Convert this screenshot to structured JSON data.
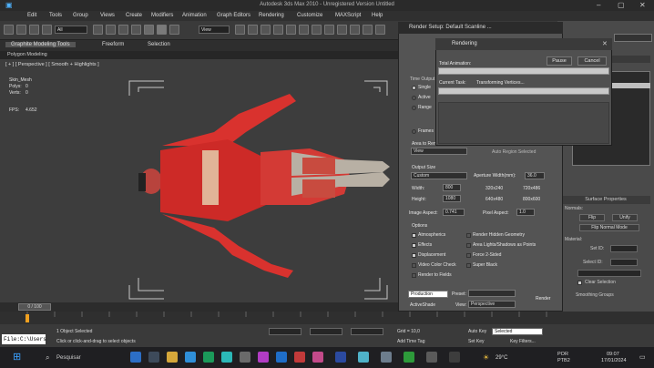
{
  "window": {
    "title": "Autodesk 3ds Max  2010   - Unregistered Version      Untitled"
  },
  "menu": [
    "Edit",
    "Tools",
    "Group",
    "Views",
    "Create",
    "Modifiers",
    "Animation",
    "Graph Editors",
    "Rendering",
    "Customize",
    "MAXScript",
    "Help"
  ],
  "toolbar": {
    "select_filter": "All",
    "ref_coord": "View"
  },
  "ribbon": {
    "tabs": [
      "Graphite Modeling Tools",
      "Freeform",
      "Selection"
    ],
    "sub": "Polygon Modeling"
  },
  "viewport": {
    "label": "[ + ] [ Perspective ] [ Smooth + Highlights ]",
    "stats": {
      "object": "Skin_Mesh",
      "polys_label": "Polys:",
      "polys_value": "0",
      "verts_label": "Verts:",
      "verts_value": "0",
      "fps_label": "FPS:",
      "fps_value": "4.652"
    }
  },
  "time": {
    "position": "0 / 100"
  },
  "render_setup": {
    "title": "Render Setup: Default Scanline ...",
    "time_output": "Time Output",
    "options": [
      "Single",
      "Active",
      "Range",
      "Frames"
    ],
    "area_label": "Area to Render",
    "area_value": "View",
    "auto_region": "Auto Region Selected",
    "output_size": "Output Size",
    "size_preset": "Custom",
    "aperture_label": "Aperture Width(mm):",
    "aperture_value": "36.0",
    "width_label": "Width:",
    "width_value": "800",
    "height_label": "Height:",
    "height_value": "1080",
    "presets": [
      "320x240",
      "720x486",
      "640x480",
      "800x600"
    ],
    "image_aspect_label": "Image Aspect:",
    "image_aspect_value": "0.741",
    "pixel_aspect_label": "Pixel Aspect:",
    "pixel_aspect_value": "1.0",
    "options_header": "Options",
    "checks_left": [
      "Atmospherics",
      "Effects",
      "Displacement",
      "Video Color Check",
      "Render to Fields"
    ],
    "checks_right": [
      "Render Hidden Geometry",
      "Area Lights/Shadows as Points",
      "Force 2-Sided",
      "Super Black"
    ],
    "mode": "Production",
    "preset_label": "Preset:",
    "activeshade": "ActiveShade",
    "view_label": "View:",
    "view_value": "Perspective",
    "render_btn": "Render"
  },
  "progress": {
    "title": "Rendering",
    "total_label": "Total Animation:",
    "current_label": "Current Task:",
    "current_value": "Transforming Vertices...",
    "pause": "Pause",
    "cancel": "Cancel",
    "total_fraction": 0.0,
    "current_fraction": 0.0
  },
  "cmdpanel": {
    "surface_props": "Surface Properties",
    "normals": "Normals:",
    "flip": "Flip",
    "unify": "Unify",
    "flip_normal_mode": "Flip Normal Mode",
    "material": "Material:",
    "set_id": "Set ID:",
    "select_id": "Select ID:",
    "clear_selection": "Clear Selection",
    "smoothing_groups": "Smoothing Groups"
  },
  "status": {
    "selected": "1 Object Selected",
    "prompt": "Click or click-and-drag to select objects",
    "grid": "Grid = 10,0",
    "add_time_tag": "Add Time Tag",
    "auto_key": "Auto Key",
    "selected_dd": "Selected",
    "set_key": "Set Key",
    "key_filters": "Key Filters...",
    "cmd_input": "File:C:\\Users"
  },
  "taskbar": {
    "search": "Pesquisar",
    "weather": "29°C",
    "lang": "POR",
    "layout": "PTB2",
    "time": "09:07",
    "date": "17/01/2024"
  }
}
